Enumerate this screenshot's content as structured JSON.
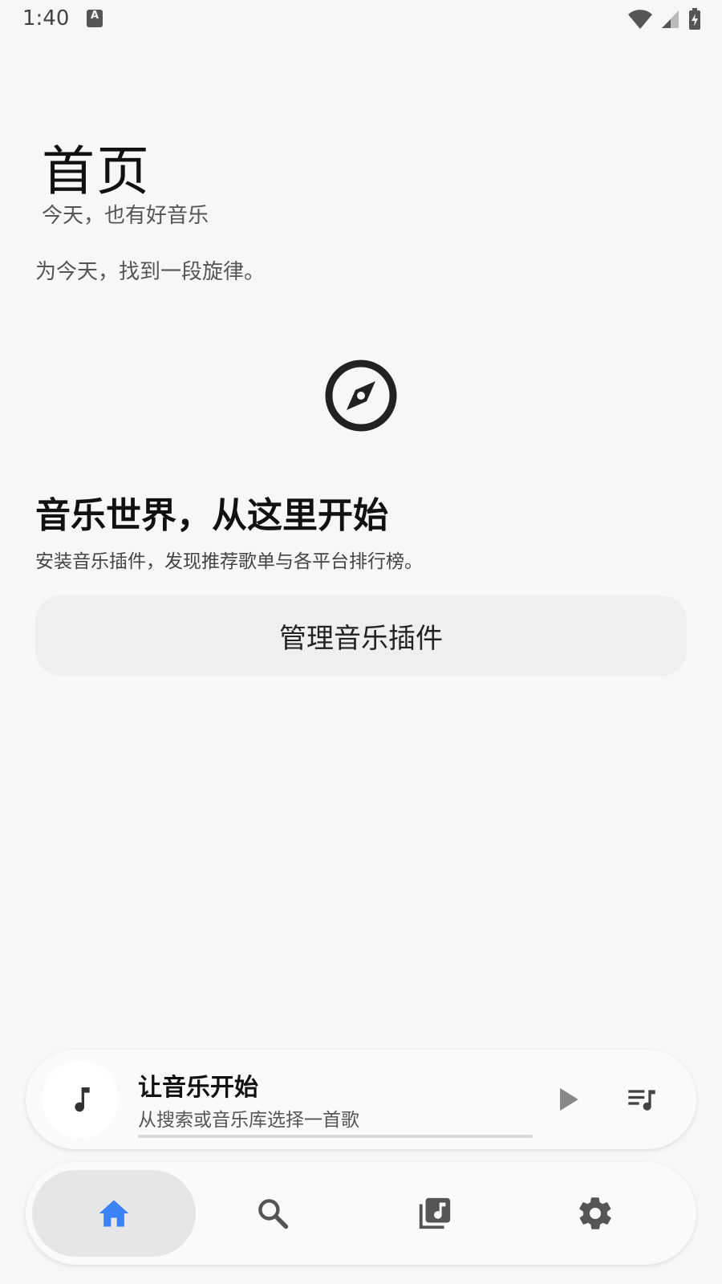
{
  "status_bar": {
    "time": "1:40",
    "notification_icon": "accessibility-a-icon",
    "notification_glyph": "A",
    "icons": [
      "wifi-icon",
      "cellular-signal-icon",
      "battery-charging-icon"
    ]
  },
  "header": {
    "title": "首页",
    "subtitle": "今天，也有好音乐"
  },
  "tagline": "为今天，找到一段旋律。",
  "empty_state": {
    "icon": "compass-icon",
    "title": "音乐世界，从这里开始",
    "description": "安装音乐插件，发现推荐歌单与各平台排行榜。",
    "button_label": "管理音乐插件"
  },
  "mini_player": {
    "title": "让音乐开始",
    "subtitle": "从搜索或音乐库选择一首歌",
    "progress": 0,
    "cover_icon": "music-note-icon",
    "play_icon": "play-icon",
    "queue_icon": "queue-music-icon"
  },
  "bottom_nav": {
    "items": [
      {
        "id": "home",
        "icon": "home-icon",
        "active": true
      },
      {
        "id": "search",
        "icon": "search-icon",
        "active": false
      },
      {
        "id": "library",
        "icon": "music-library-icon",
        "active": false
      },
      {
        "id": "settings",
        "icon": "gear-icon",
        "active": false
      }
    ]
  },
  "colors": {
    "background": "#f7f7f7",
    "accent": "#3b82f6",
    "icon_gray": "#555555",
    "text_primary": "#111111",
    "text_secondary": "#555555"
  }
}
